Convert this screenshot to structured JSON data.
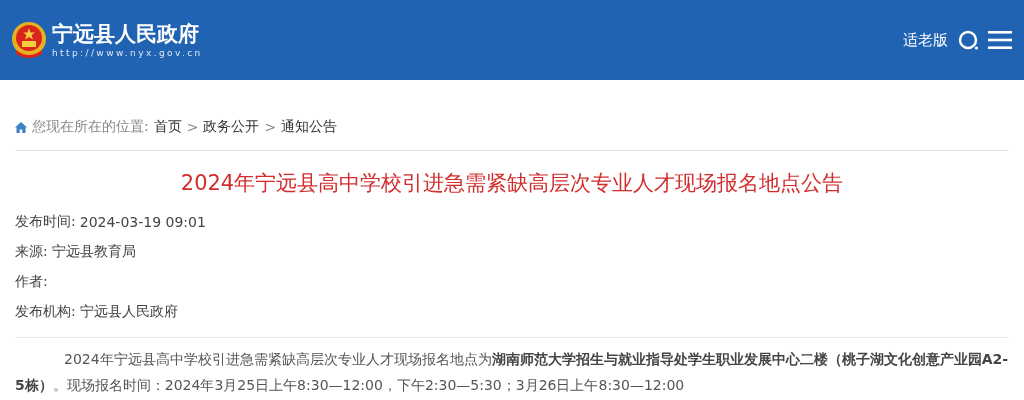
{
  "header": {
    "site_name": "宁远县人民政府",
    "site_url": "http://www.nyx.gov.cn",
    "elder_mode": "适老版"
  },
  "breadcrumb": {
    "prefix": "您现在所在的位置:",
    "items": [
      "首页",
      "政务公开",
      "通知公告"
    ],
    "separator": ">"
  },
  "article": {
    "title": "2024年宁远县高中学校引进急需紧缺高层次专业人才现场报名地点公告",
    "meta": [
      {
        "label": "发布时间:",
        "value": "2024-03-19 09:01"
      },
      {
        "label": "来源:",
        "value": "宁远县教育局"
      },
      {
        "label": "作者:"
      },
      {
        "label": "发布机构:",
        "value": "宁远县人民政府"
      }
    ],
    "body": "2024年宁远县高中学校引进急需紧缺高层次专业人才现场报名地点为**湖南师范大学招生与就业指导处学生职业发展中心二楼（桃子湖文化创意产业园A2-5栋）**。现场报名时间：2024年3月25日上午8:30—12:00，下午2:30—5:30；3月26日上午8:30—12:00"
  }
}
